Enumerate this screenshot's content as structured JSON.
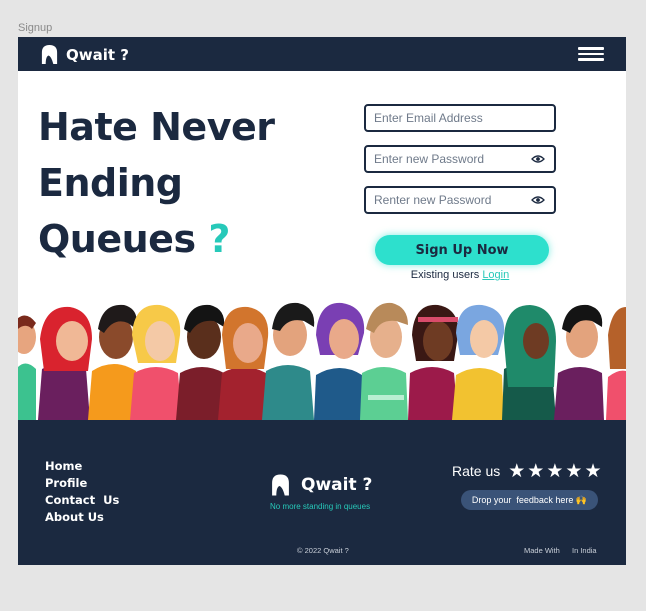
{
  "frame": {
    "label": "Signup"
  },
  "navbar": {
    "brand": "Qwait ?",
    "logo_icon": "qwait-logo-icon",
    "menu_icon": "hamburger-menu-icon"
  },
  "hero": {
    "line1": "Hate Never",
    "line2": "Ending",
    "line3": "Queues",
    "question_mark": "?"
  },
  "form": {
    "email_placeholder": "Enter Email Address",
    "password_placeholder": "Enter new Password",
    "confirm_placeholder": "Renter new Password",
    "eye_icon": "eye-icon",
    "signup_label": "Sign Up Now",
    "existing_text": "Existing users",
    "login_label": "Login"
  },
  "illustration": {
    "name": "crowd-illustration"
  },
  "footer": {
    "links": [
      "Home",
      "Profile",
      "Contact  Us",
      "About Us"
    ],
    "brand": "Qwait ?",
    "tagline": "No more standing in queues",
    "rate_label": "Rate us",
    "star_icon": "star-icon",
    "feedback_label": "Drop your  feedback here 🙌",
    "copyright": "© 2022 Qwait ?",
    "made_with": "Made With",
    "in_india": "In India"
  },
  "colors": {
    "navy": "#1b2940",
    "accent": "#2de0cd",
    "teal_text": "#27c9b9",
    "feedback_bg": "#3a5378"
  }
}
